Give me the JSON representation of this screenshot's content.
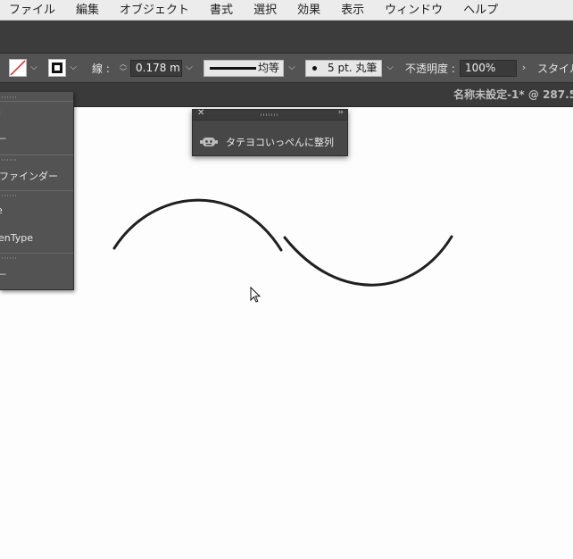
{
  "menubar": {
    "items": [
      "ファイル",
      "編集",
      "オブジェクト",
      "書式",
      "選択",
      "効果",
      "表示",
      "ウィンドウ",
      "ヘルプ"
    ]
  },
  "control_bar": {
    "stroke_label": "線 :",
    "stroke_weight": "0.178 m",
    "stroke_style": "均等",
    "brush": "5 pt. 丸筆",
    "opacity_label": "不透明度 :",
    "opacity_value": "100%",
    "style_label": "スタイル",
    "fill_swatch": "none",
    "stroke_swatch": "black"
  },
  "document": {
    "title": "名称未設定-1* @ 287.5"
  },
  "left_panel": {
    "items": [
      "",
      "",
      "パスファインダー",
      "",
      "OpenType",
      ""
    ],
    "visible_fragments": [
      "l",
      "—",
      "まファインダー",
      "e",
      "enType",
      "—"
    ]
  },
  "plugin_panel": {
    "label": "タテヨコいっぺんに整列",
    "icon": "robot-icon"
  },
  "colors": {
    "menubar_bg": "#ececec",
    "control_bar_bg": "#535353",
    "panel_bg": "#535353",
    "canvas_bg": "#fdfdfd",
    "stroke_color": "#1f1f1f"
  }
}
